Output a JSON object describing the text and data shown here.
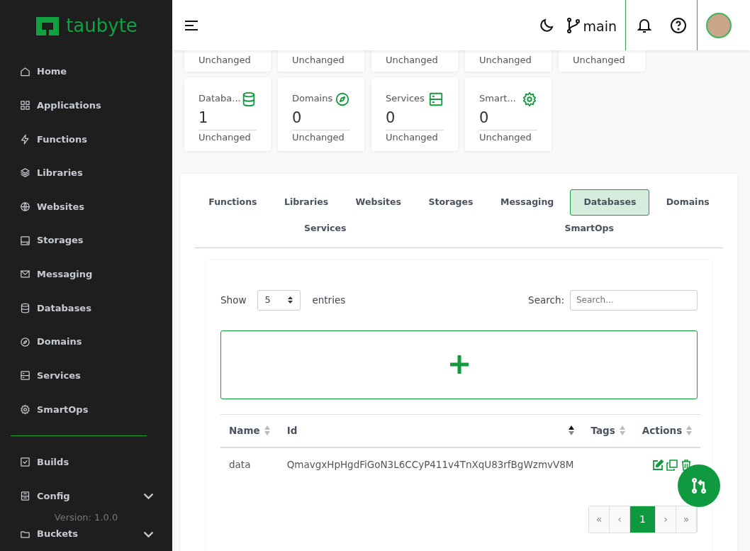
{
  "sidebar": {
    "logo": "taubyte",
    "items": [
      {
        "label": "Home"
      },
      {
        "label": "Applications"
      },
      {
        "label": "Functions"
      },
      {
        "label": "Libraries"
      },
      {
        "label": "Websites"
      },
      {
        "label": "Storages"
      },
      {
        "label": "Messaging"
      },
      {
        "label": "Databases"
      },
      {
        "label": "Domains"
      },
      {
        "label": "Services"
      },
      {
        "label": "SmartOps"
      }
    ],
    "bottom_items": [
      {
        "label": "Builds",
        "expandable": false
      },
      {
        "label": "Config",
        "expandable": true
      },
      {
        "label": "Buckets",
        "expandable": true
      }
    ],
    "version": "Version: 1.0.0"
  },
  "header": {
    "branch": "main"
  },
  "top_cards": [
    {
      "status": "Unchanged"
    },
    {
      "status": "Unchanged"
    },
    {
      "status": "Unchanged"
    },
    {
      "status": "Unchanged"
    },
    {
      "status": "Unchanged"
    }
  ],
  "cards": [
    {
      "title": "Databa...",
      "value": "1",
      "status": "Unchanged"
    },
    {
      "title": "Domains",
      "value": "0",
      "status": "Unchanged"
    },
    {
      "title": "Services",
      "value": "0",
      "status": "Unchanged"
    },
    {
      "title": "Smart...",
      "value": "0",
      "status": "Unchanged"
    }
  ],
  "tabs": [
    {
      "label": "Functions",
      "selected": false
    },
    {
      "label": "Libraries",
      "selected": false
    },
    {
      "label": "Websites",
      "selected": false
    },
    {
      "label": "Storages",
      "selected": false
    },
    {
      "label": "Messaging",
      "selected": false
    },
    {
      "label": "Databases",
      "selected": true
    },
    {
      "label": "Domains",
      "selected": false
    },
    {
      "label": "Services",
      "selected": false
    },
    {
      "label": "SmartOps",
      "selected": false
    }
  ],
  "table_controls": {
    "show_label": "Show",
    "page_size": "5",
    "entries_label": "entries",
    "search_label": "Search:",
    "search_placeholder": "Search..."
  },
  "table": {
    "columns": [
      {
        "label": "Name",
        "sorted": false
      },
      {
        "label": "Id",
        "sorted": true
      },
      {
        "label": "Tags",
        "sorted": false
      },
      {
        "label": "Actions",
        "sorted": false
      }
    ],
    "rows": [
      {
        "name": "data",
        "id": "QmavgxHpHgdFiGoN3L6CCyP411v4TnXqU83rfBgWzmvV8M"
      }
    ]
  },
  "pagination": [
    {
      "label": "«",
      "selected": false,
      "disabled": true
    },
    {
      "label": "‹",
      "selected": false,
      "disabled": true
    },
    {
      "label": "1",
      "selected": true,
      "disabled": false
    },
    {
      "label": "›",
      "selected": false,
      "disabled": true
    },
    {
      "label": "»",
      "selected": false,
      "disabled": true
    }
  ]
}
